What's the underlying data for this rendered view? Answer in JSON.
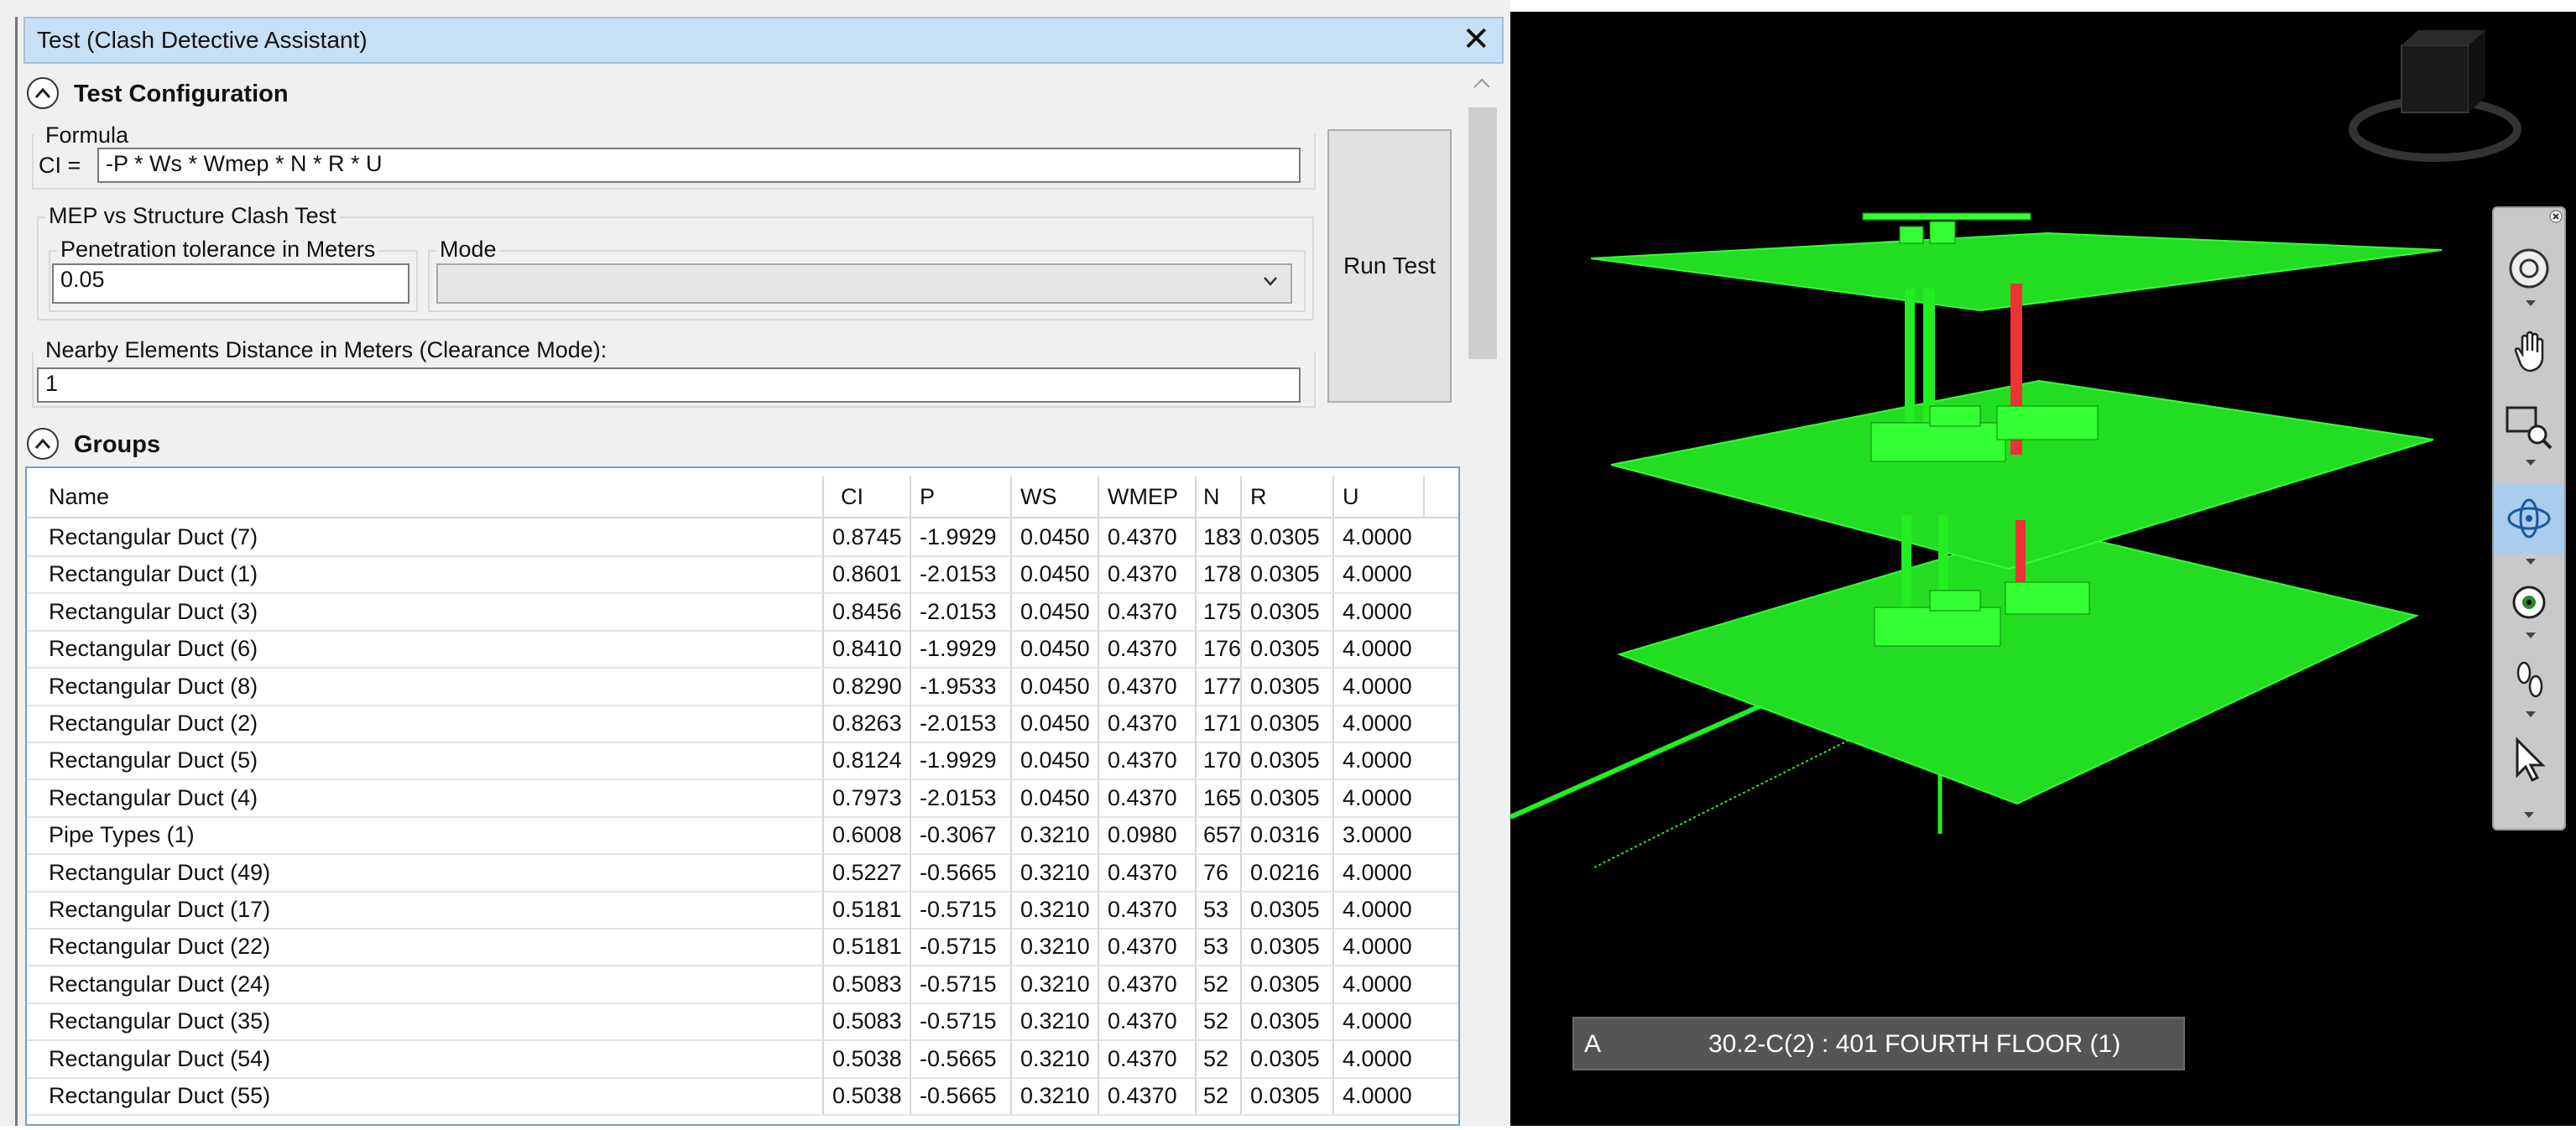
{
  "window": {
    "title": "Test (Clash Detective Assistant)",
    "close_glyph": "✕"
  },
  "config": {
    "section_title": "Test Configuration",
    "formula_label": "Formula",
    "formula_prefix": "CI =",
    "formula_value": "-P * Ws * Wmep * N * R * U",
    "mep_group_label": "MEP vs Structure Clash Test",
    "tolerance_label": "Penetration tolerance in Meters",
    "tolerance_value": "0.05",
    "mode_label": "Mode",
    "mode_value": "",
    "run_button": "Run Test",
    "nearby_label": "Nearby Elements Distance in Meters (Clearance Mode):",
    "nearby_value": "1"
  },
  "groups": {
    "section_title": "Groups",
    "columns": [
      "Name",
      "CI",
      "P",
      "WS",
      "WMEP",
      "N",
      "R",
      "U"
    ],
    "rows": [
      [
        "Rectangular Duct (7)",
        "0.8745",
        "-1.9929",
        "0.0450",
        "0.4370",
        "183",
        "0.0305",
        "4.0000"
      ],
      [
        "Rectangular Duct (1)",
        "0.8601",
        "-2.0153",
        "0.0450",
        "0.4370",
        "178",
        "0.0305",
        "4.0000"
      ],
      [
        "Rectangular Duct (3)",
        "0.8456",
        "-2.0153",
        "0.0450",
        "0.4370",
        "175",
        "0.0305",
        "4.0000"
      ],
      [
        "Rectangular Duct (6)",
        "0.8410",
        "-1.9929",
        "0.0450",
        "0.4370",
        "176",
        "0.0305",
        "4.0000"
      ],
      [
        "Rectangular Duct (8)",
        "0.8290",
        "-1.9533",
        "0.0450",
        "0.4370",
        "177",
        "0.0305",
        "4.0000"
      ],
      [
        "Rectangular Duct (2)",
        "0.8263",
        "-2.0153",
        "0.0450",
        "0.4370",
        "171",
        "0.0305",
        "4.0000"
      ],
      [
        "Rectangular Duct (5)",
        "0.8124",
        "-1.9929",
        "0.0450",
        "0.4370",
        "170",
        "0.0305",
        "4.0000"
      ],
      [
        "Rectangular Duct (4)",
        "0.7973",
        "-2.0153",
        "0.0450",
        "0.4370",
        "165",
        "0.0305",
        "4.0000"
      ],
      [
        "Pipe Types (1)",
        "0.6008",
        "-0.3067",
        "0.3210",
        "0.0980",
        "657",
        "0.0316",
        "3.0000"
      ],
      [
        "Rectangular Duct (49)",
        "0.5227",
        "-0.5665",
        "0.3210",
        "0.4370",
        "76",
        "0.0216",
        "4.0000"
      ],
      [
        "Rectangular Duct (17)",
        "0.5181",
        "-0.5715",
        "0.3210",
        "0.4370",
        "53",
        "0.0305",
        "4.0000"
      ],
      [
        "Rectangular Duct (22)",
        "0.5181",
        "-0.5715",
        "0.3210",
        "0.4370",
        "53",
        "0.0305",
        "4.0000"
      ],
      [
        "Rectangular Duct (24)",
        "0.5083",
        "-0.5715",
        "0.3210",
        "0.4370",
        "52",
        "0.0305",
        "4.0000"
      ],
      [
        "Rectangular Duct (35)",
        "0.5083",
        "-0.5715",
        "0.3210",
        "0.4370",
        "52",
        "0.0305",
        "4.0000"
      ],
      [
        "Rectangular Duct (54)",
        "0.5038",
        "-0.5665",
        "0.3210",
        "0.4370",
        "52",
        "0.0305",
        "4.0000"
      ],
      [
        "Rectangular Duct (55)",
        "0.5038",
        "-0.5665",
        "0.3210",
        "0.4370",
        "52",
        "0.0305",
        "4.0000"
      ]
    ]
  },
  "viewport": {
    "background": "#000000",
    "model_color": "#22ee22",
    "clash_color": "#ee3333",
    "status_letter": "A",
    "status_text": "30.2-C(2) : 401 FOURTH FLOOR (1)",
    "nav_tools": [
      "steering-wheel-icon",
      "pan-icon",
      "zoom-window-icon",
      "orbit-icon",
      "look-icon",
      "walk-icon",
      "select-icon"
    ]
  }
}
